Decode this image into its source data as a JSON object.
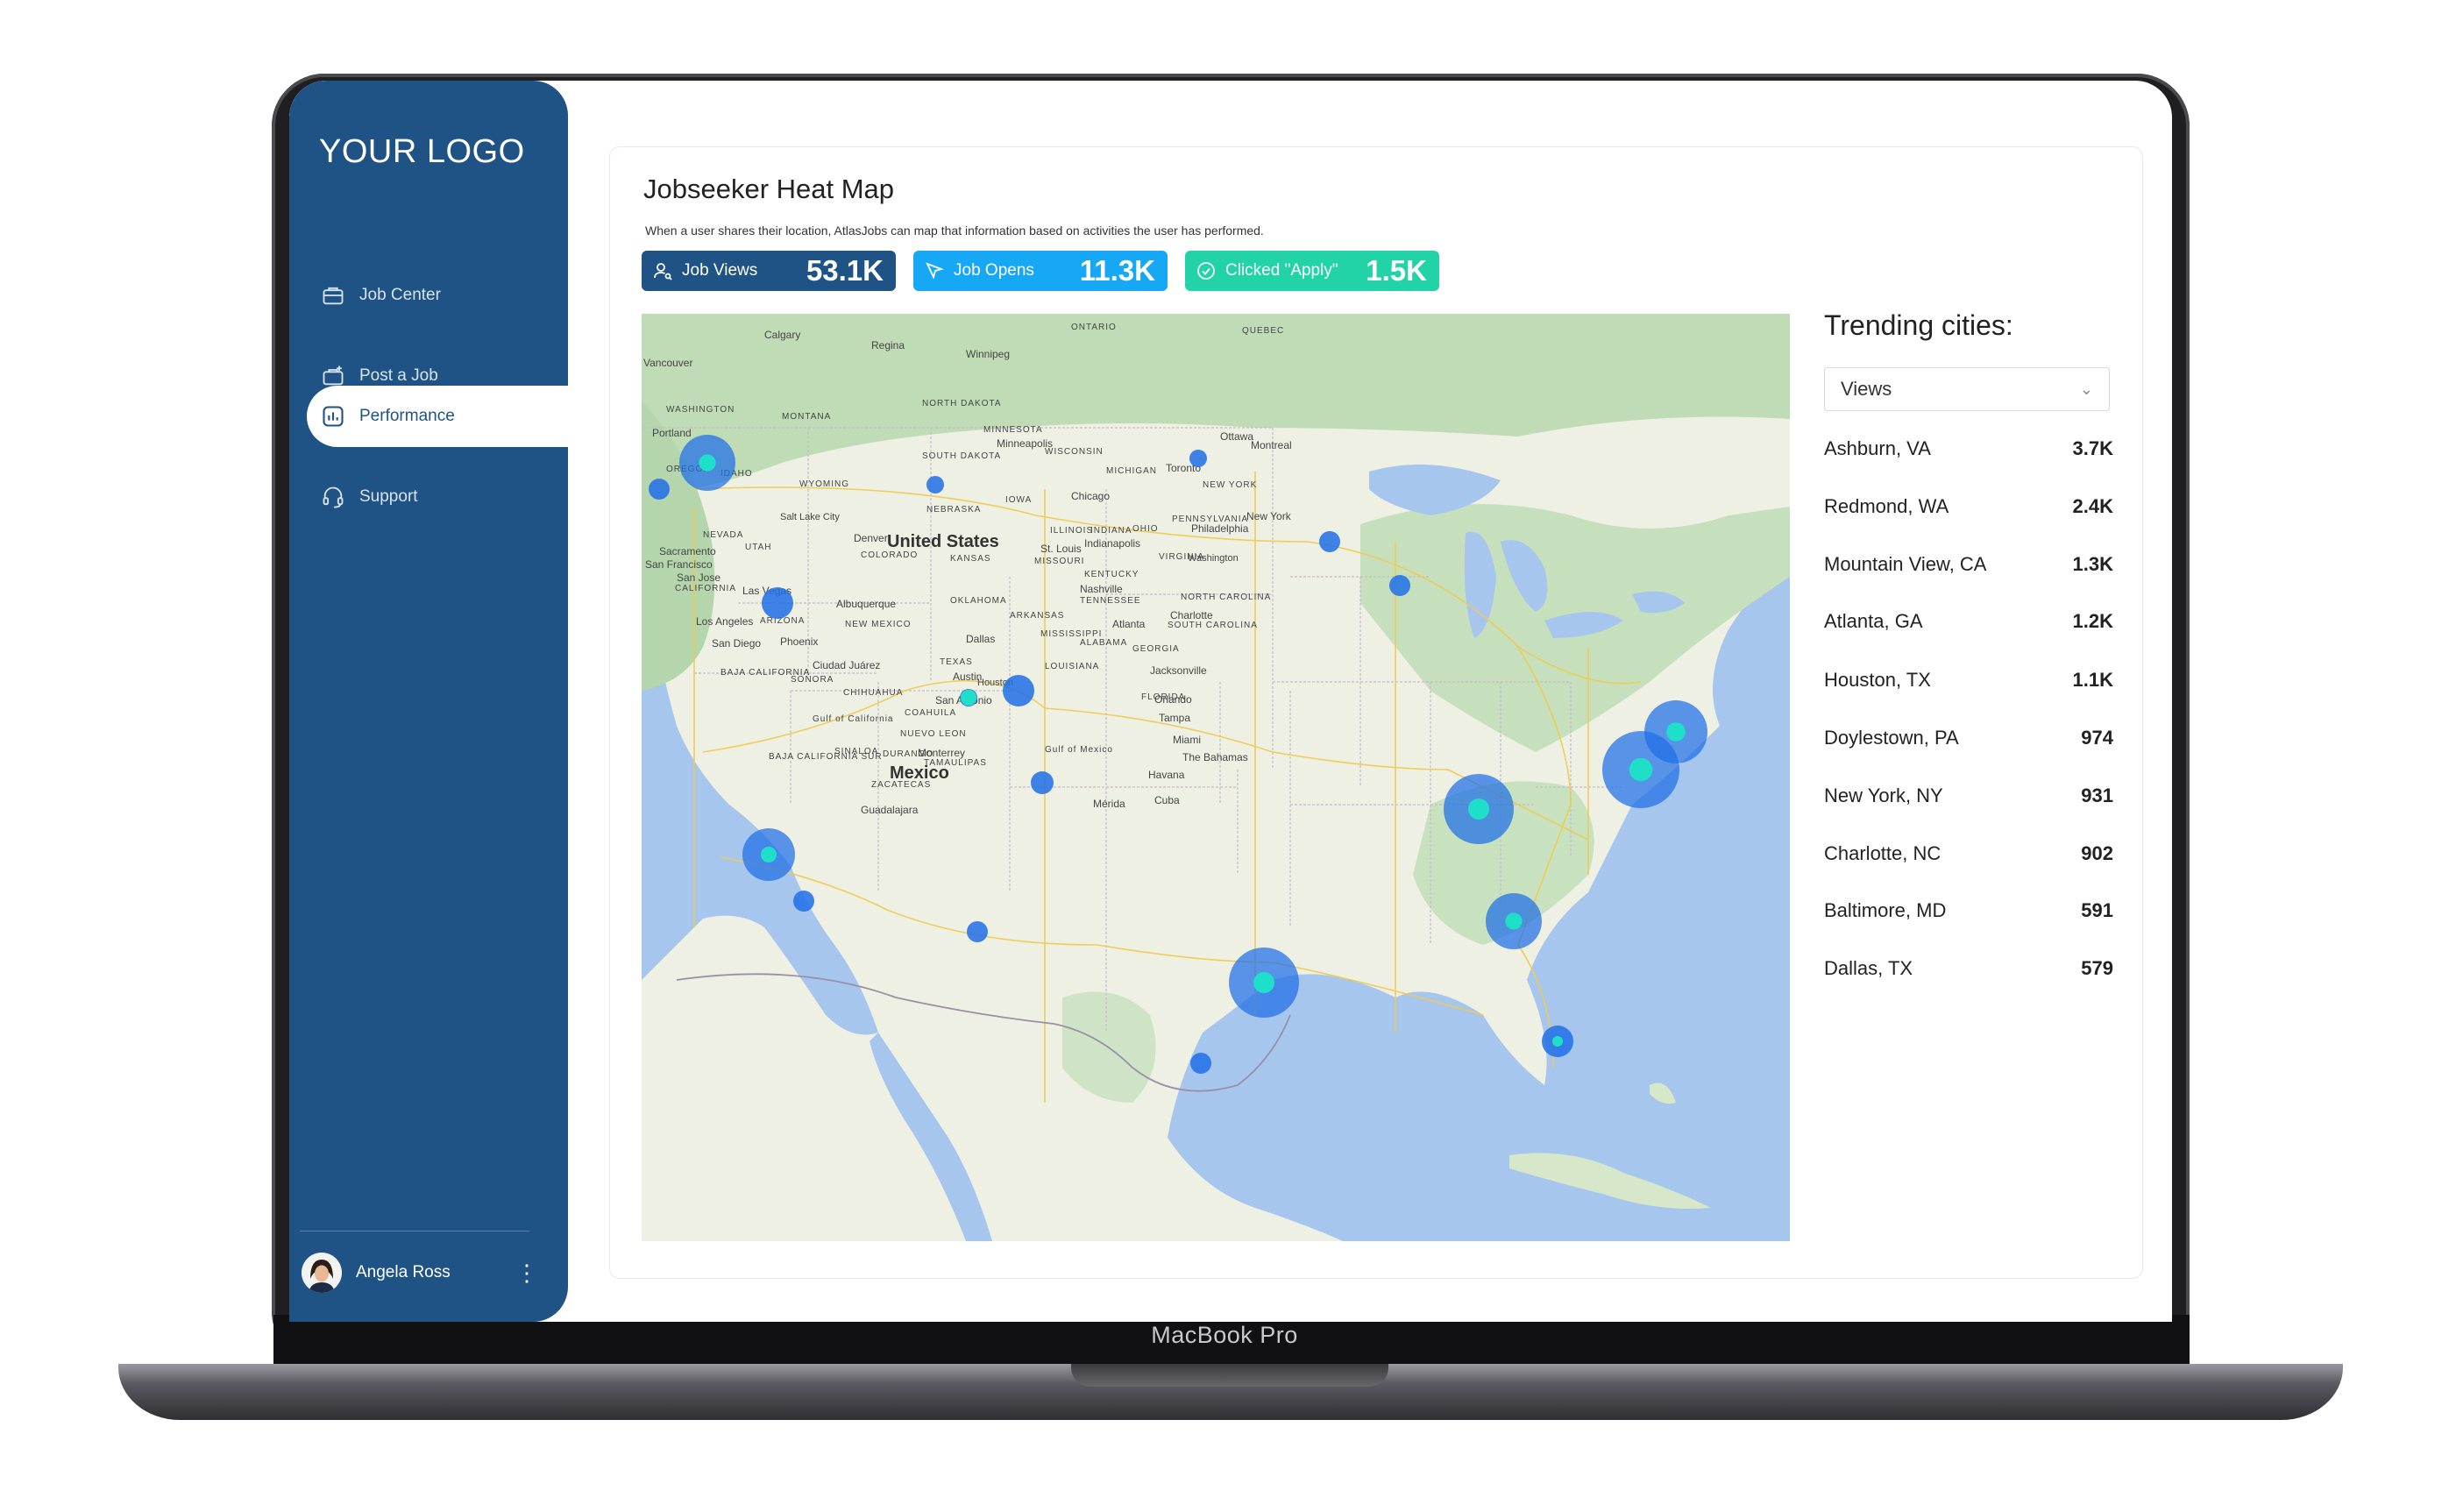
{
  "sidebar": {
    "logo": "YOUR LOGO",
    "items": [
      {
        "label": "Job Center",
        "icon": "briefcase-icon"
      },
      {
        "label": "Post a Job",
        "icon": "post-job-icon"
      },
      {
        "label": "Performance",
        "icon": "chart-icon",
        "active": true
      },
      {
        "label": "Support",
        "icon": "headset-icon"
      }
    ],
    "user": {
      "name": "Angela Ross"
    }
  },
  "header": {
    "title": "Jobseeker Heat Map",
    "subtitle": "When a user shares their location, AtlasJobs can map that information based on activities the user has performed."
  },
  "stats": [
    {
      "label": "Job Views",
      "value": "53.1K",
      "color": "#1f5285",
      "icon": "user-search-icon"
    },
    {
      "label": "Job Opens",
      "value": "11.3K",
      "color": "#16a7f5",
      "icon": "cursor-icon"
    },
    {
      "label": "Clicked \"Apply\"",
      "value": "1.5K",
      "color": "#22d3a8",
      "icon": "check-circle-icon"
    }
  ],
  "map": {
    "labels": {
      "country": "United States",
      "mexico": "Mexico",
      "cities": [
        "Vancouver",
        "Calgary",
        "Regina",
        "Winnipeg",
        "Portland",
        "Sacramento",
        "San Francisco",
        "San Jose",
        "Las Vegas",
        "Los Angeles",
        "San Diego",
        "Phoenix",
        "Salt Lake City",
        "Denver",
        "Albuquerque",
        "Ciudad Juárez",
        "Dallas",
        "Austin",
        "Houston",
        "San Antonio",
        "Minneapolis",
        "Chicago",
        "St. Louis",
        "Indianapolis",
        "Nashville",
        "Atlanta",
        "Charlotte",
        "Washington",
        "Philadelphia",
        "New York",
        "Toronto",
        "Ottawa",
        "Montreal",
        "Jacksonville",
        "Orlando",
        "Tampa",
        "Miami",
        "Havana",
        "Monterrey",
        "Guadalajara",
        "Mérida",
        "Cuba",
        "The Bahamas"
      ],
      "regions": [
        "WASHINGTON",
        "OREGON",
        "IDAHO",
        "MONTANA",
        "WYOMING",
        "NEVADA",
        "UTAH",
        "COLORADO",
        "CALIFORNIA",
        "ARIZONA",
        "NEW MEXICO",
        "TEXAS",
        "OKLAHOMA",
        "KANSAS",
        "NEBRASKA",
        "SOUTH DAKOTA",
        "NORTH DAKOTA",
        "MINNESOTA",
        "IOWA",
        "MISSOURI",
        "ARKANSAS",
        "LOUISIANA",
        "MISSISSIPPI",
        "ALABAMA",
        "GEORGIA",
        "TENNESSEE",
        "KENTUCKY",
        "ILLINOIS",
        "INDIANA",
        "OHIO",
        "MICHIGAN",
        "WISCONSIN",
        "PENNSYLVANIA",
        "NEW YORK",
        "VIRGINIA",
        "NORTH CAROLINA",
        "SOUTH CAROLINA",
        "FLORIDA",
        "ONTARIO",
        "QUEBEC",
        "SONORA",
        "CHIHUAHUA",
        "COAHUILA",
        "NUEVO LEON",
        "TAMAULIPAS",
        "SINALOA",
        "DURANGO",
        "ZACATECAS",
        "BAJA CALIFORNIA",
        "BAJA CALIFORNIA SUR",
        "Gulf of Mexico",
        "Gulf of California"
      ]
    },
    "colors": {
      "land": "#e9efe2",
      "forest": "#b9dab3",
      "water": "#a7c6ee",
      "hotspot": "#1e6fe8",
      "hotspot_core": "#1ee0c8"
    }
  },
  "trending": {
    "title": "Trending cities:",
    "select_value": "Views",
    "cities": [
      {
        "name": "Ashburn, VA",
        "value": "3.7K"
      },
      {
        "name": "Redmond, WA",
        "value": "2.4K"
      },
      {
        "name": "Mountain View, CA",
        "value": "1.3K"
      },
      {
        "name": "Atlanta, GA",
        "value": "1.2K"
      },
      {
        "name": "Houston, TX",
        "value": "1.1K"
      },
      {
        "name": "Doylestown, PA",
        "value": "974"
      },
      {
        "name": "New York, NY",
        "value": "931"
      },
      {
        "name": "Charlotte, NC",
        "value": "902"
      },
      {
        "name": "Baltimore, MD",
        "value": "591"
      },
      {
        "name": "Dallas, TX",
        "value": "579"
      }
    ]
  },
  "device": {
    "label": "MacBook Pro"
  }
}
